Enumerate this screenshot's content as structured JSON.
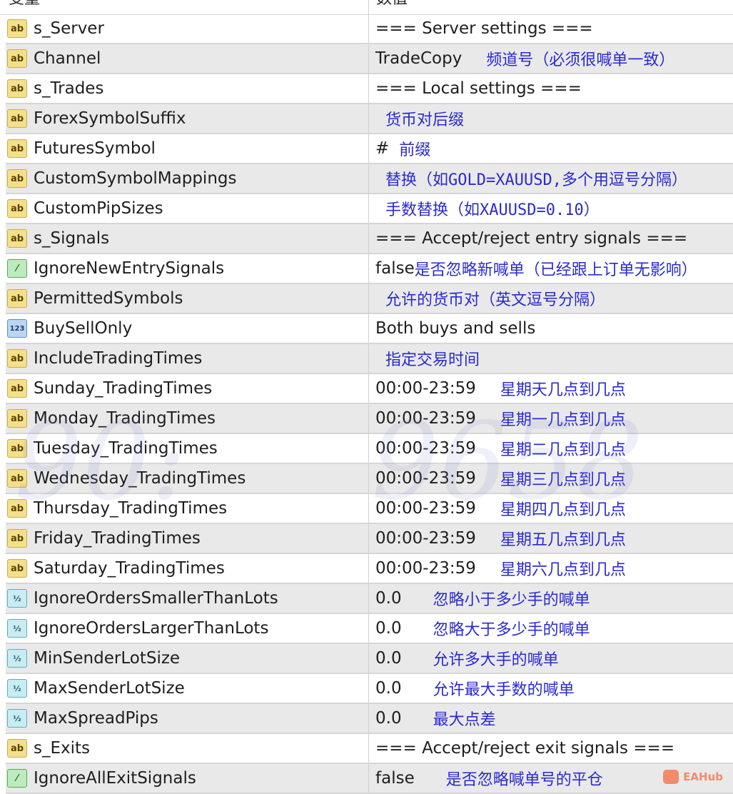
{
  "header": {
    "name": "变量",
    "value": "数值"
  },
  "rows": [
    {
      "icon": "ab",
      "name": "s_Server",
      "value": "=== Server settings ===",
      "comment": ""
    },
    {
      "icon": "ab",
      "name": "Channel",
      "value": "TradeCopy",
      "comment": "频道号（必须很喊单一致）"
    },
    {
      "icon": "ab",
      "name": "s_Trades",
      "value": "=== Local settings ===",
      "comment": ""
    },
    {
      "icon": "ab",
      "name": "ForexSymbolSuffix",
      "value": "",
      "comment": "货币对后缀"
    },
    {
      "icon": "ab",
      "name": "FuturesSymbol",
      "value": "#",
      "comment": "前缀"
    },
    {
      "icon": "ab",
      "name": "CustomSymbolMappings",
      "value": "",
      "comment": "替换（如GOLD=XAUUSD,多个用逗号分隔）"
    },
    {
      "icon": "ab",
      "name": "CustomPipSizes",
      "value": "",
      "comment": "手数替换（如XAUUSD=0.10）"
    },
    {
      "icon": "ab",
      "name": "s_Signals",
      "value": "=== Accept/reject entry signals ===",
      "comment": ""
    },
    {
      "icon": "bool",
      "name": "IgnoreNewEntrySignals",
      "value": "false",
      "comment": "是否忽略新喊单（已经跟上订单无影响）"
    },
    {
      "icon": "ab",
      "name": "PermittedSymbols",
      "value": "",
      "comment": "允许的货币对（英文逗号分隔）"
    },
    {
      "icon": "int",
      "name": "BuySellOnly",
      "value": "Both buys and sells",
      "comment": ""
    },
    {
      "icon": "ab",
      "name": "IncludeTradingTimes",
      "value": "",
      "comment": "指定交易时间"
    },
    {
      "icon": "ab",
      "name": "Sunday_TradingTimes",
      "value": "00:00-23:59",
      "comment": "星期天几点到几点"
    },
    {
      "icon": "ab",
      "name": "Monday_TradingTimes",
      "value": "00:00-23:59",
      "comment": "星期一几点到几点"
    },
    {
      "icon": "ab",
      "name": "Tuesday_TradingTimes",
      "value": "00:00-23:59",
      "comment": "星期二几点到几点"
    },
    {
      "icon": "ab",
      "name": "Wednesday_TradingTimes",
      "value": "00:00-23:59",
      "comment": "星期三几点到几点"
    },
    {
      "icon": "ab",
      "name": "Thursday_TradingTimes",
      "value": "00:00-23:59",
      "comment": "星期四几点到几点"
    },
    {
      "icon": "ab",
      "name": "Friday_TradingTimes",
      "value": "00:00-23:59",
      "comment": "星期五几点到几点"
    },
    {
      "icon": "ab",
      "name": "Saturday_TradingTimes",
      "value": "00:00-23:59",
      "comment": "星期六几点到几点"
    },
    {
      "icon": "dbl",
      "name": "IgnoreOrdersSmallerThanLots",
      "value": "0.0",
      "comment": "忽略小于多少手的喊单"
    },
    {
      "icon": "dbl",
      "name": "IgnoreOrdersLargerThanLots",
      "value": "0.0",
      "comment": "忽略大于多少手的喊单"
    },
    {
      "icon": "dbl",
      "name": "MinSenderLotSize",
      "value": "0.0",
      "comment": "允许多大手的喊单"
    },
    {
      "icon": "dbl",
      "name": "MaxSenderLotSize",
      "value": "0.0",
      "comment": "允许最大手数的喊单"
    },
    {
      "icon": "dbl",
      "name": "MaxSpreadPips",
      "value": "0.0",
      "comment": "最大点差"
    },
    {
      "icon": "ab",
      "name": "s_Exits",
      "value": "=== Accept/reject exit signals ===",
      "comment": ""
    },
    {
      "icon": "bool",
      "name": "IgnoreAllExitSignals",
      "value": "false",
      "comment": "是否忽略喊单号的平仓"
    }
  ],
  "icon_labels": {
    "ab": "ab",
    "bool": "⁄",
    "int": "123",
    "dbl": "½"
  },
  "colors": {
    "comment": "#2a2ad0",
    "row_alt": "#e9e9e9"
  },
  "watermark": {
    "left": "90:",
    "right": "9658"
  },
  "logo": {
    "text": "EAHub"
  }
}
